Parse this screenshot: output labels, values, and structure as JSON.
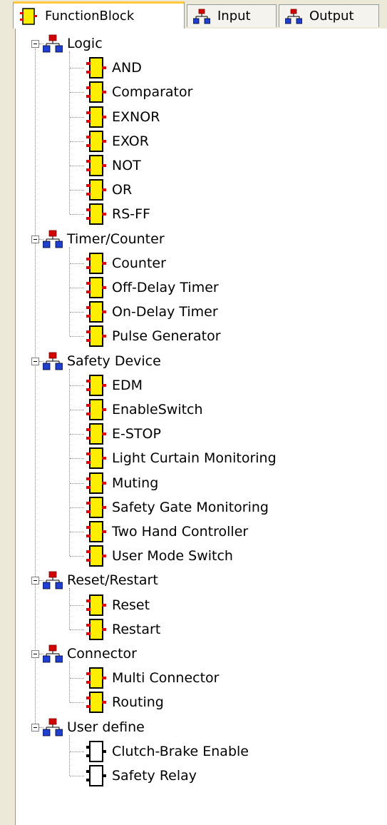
{
  "tabs": [
    {
      "label": "FunctionBlock",
      "icon": "function-block-icon",
      "active": true
    },
    {
      "label": "Input",
      "icon": "network-icon",
      "active": false
    },
    {
      "label": "Output",
      "icon": "network-icon",
      "active": false
    }
  ],
  "tree": [
    {
      "label": "Logic",
      "items": [
        "AND",
        "Comparator",
        "EXNOR",
        "EXOR",
        "NOT",
        "OR",
        "RS-FF"
      ]
    },
    {
      "label": "Timer/Counter",
      "items": [
        "Counter",
        "Off-Delay Timer",
        "On-Delay Timer",
        "Pulse Generator"
      ]
    },
    {
      "label": "Safety Device",
      "items": [
        "EDM",
        "EnableSwitch",
        "E-STOP",
        "Light Curtain Monitoring",
        "Muting",
        "Safety Gate Monitoring",
        "Two Hand Controller",
        "User Mode Switch"
      ]
    },
    {
      "label": "Reset/Restart",
      "items": [
        "Reset",
        "Restart"
      ]
    },
    {
      "label": "Connector",
      "items": [
        "Multi Connector",
        "Routing"
      ]
    },
    {
      "label": "User define",
      "items": [
        "Clutch-Brake Enable",
        "Safety Relay"
      ],
      "outline": true
    }
  ],
  "colors": {
    "block_fill": "#ffee00",
    "block_pin": "#e00000",
    "folder_red": "#d40000",
    "folder_blue": "#1f3fd0"
  }
}
